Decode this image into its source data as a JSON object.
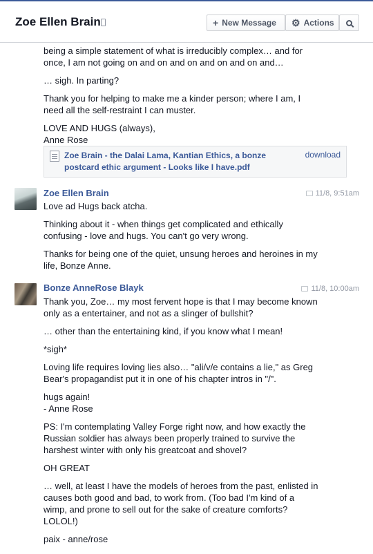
{
  "header": {
    "title": "Zoe Ellen Brain",
    "new_message_label": "New Message",
    "actions_label": "Actions"
  },
  "continued": {
    "lines": [
      "being a simple statement of what is irreducibly complex… and for",
      "once, I am not going on and on and on and on and on and…",
      "… sigh.  In parting?",
      "Thank you for helping to make me a kinder person; where I am, I",
      "need all the self-restraint I can muster.",
      "LOVE AND HUGS (always),",
      "Anne Rose"
    ],
    "attachment": {
      "name": "Zoe Brain - the Dalai Lama, Kantian Ethics, a bonze postcard ethic argument - Looks like I have.pdf",
      "download_label": "download"
    }
  },
  "messages": [
    {
      "sender": "Zoe Ellen Brain",
      "time": "11/8, 9:51am",
      "paragraphs": [
        [
          "Love ad Hugs back atcha."
        ],
        [
          "Thinking about it - when things get complicated and ethically",
          "confusing - love and hugs. You can't go very wrong."
        ],
        [
          "Thanks for being one of the quiet, unsung heroes and heroines in my",
          "life, Bonze Anne."
        ]
      ]
    },
    {
      "sender": "Bonze AnneRose Blayk",
      "time": "11/8, 10:00am",
      "paragraphs": [
        [
          "Thank you, Zoe… my most fervent hope is that I may become known",
          "only as a entertainer, and not as a slinger of bullshit?"
        ],
        [
          "… other than the entertaining kind, if you know what I mean!"
        ],
        [
          "*sigh*"
        ],
        [
          "Loving life requires loving lies also… \"ali/v/e contains a lie,\" as Greg",
          "Bear's propagandist put it in one of his chapter intros in \"/\"."
        ],
        [
          "hugs again!",
          "- Anne Rose"
        ],
        [
          "PS:  I'm contemplating Valley Forge right now, and how exactly the",
          "Russian soldier has always been properly trained to survive the",
          "harshest winter with only his greatcoat and shovel?"
        ],
        [
          "OH GREAT"
        ],
        [
          "… well, at least I have the models of heroes from the past, enlisted in",
          "causes both good and bad, to work from.  (Too bad I'm kind of a",
          "wimp, and prone to sell out for the sake of creature comforts?",
          "LOLOL!)"
        ],
        [
          "paix - anne/rose"
        ]
      ]
    }
  ]
}
